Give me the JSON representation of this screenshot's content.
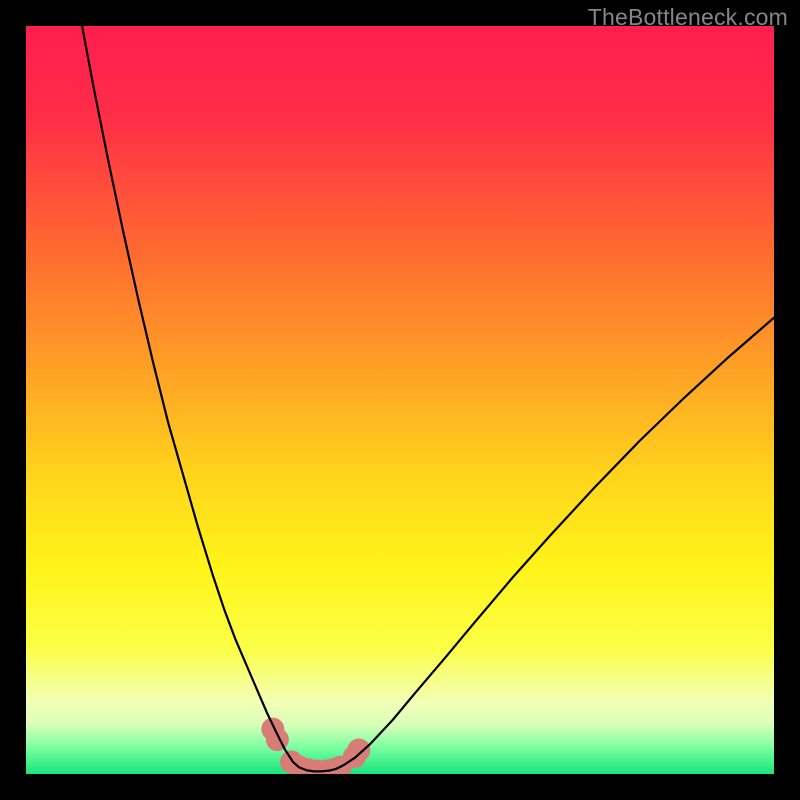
{
  "watermark": "TheBottleneck.com",
  "colors": {
    "frame": "#000000",
    "curve": "#000000",
    "marker_fill": "#d87c77",
    "marker_stroke": "#d87c77"
  },
  "chart_data": {
    "type": "line",
    "title": "",
    "xlabel": "",
    "ylabel": "",
    "xlim": [
      0,
      100
    ],
    "ylim": [
      0,
      100
    ],
    "gradient_stops": [
      {
        "pos": 0.0,
        "color": "#ff1e4e"
      },
      {
        "pos": 0.12,
        "color": "#ff2d48"
      },
      {
        "pos": 0.3,
        "color": "#ff6a30"
      },
      {
        "pos": 0.46,
        "color": "#ffa126"
      },
      {
        "pos": 0.6,
        "color": "#ffd41c"
      },
      {
        "pos": 0.72,
        "color": "#fff319"
      },
      {
        "pos": 0.83,
        "color": "#fbff45"
      },
      {
        "pos": 0.905,
        "color": "#f3ffb6"
      },
      {
        "pos": 0.935,
        "color": "#d6ffb8"
      },
      {
        "pos": 0.965,
        "color": "#7affa0"
      },
      {
        "pos": 1.0,
        "color": "#16e57c"
      }
    ],
    "series": [
      {
        "name": "left-branch",
        "x": [
          7.5,
          9,
          11,
          13,
          15,
          17,
          19,
          21,
          23,
          25,
          26.5,
          28,
          29.5,
          31,
          32.3,
          33.5,
          34.6,
          35.7
        ],
        "y": [
          100,
          92,
          82,
          72.5,
          63.5,
          55,
          47,
          40,
          33,
          26.5,
          22,
          18,
          14.5,
          11,
          8,
          5.5,
          3.3,
          1.6
        ]
      },
      {
        "name": "valley-floor",
        "x": [
          35.7,
          36.5,
          37.5,
          38.5,
          39.5,
          40.5,
          41.5,
          42.5
        ],
        "y": [
          1.6,
          0.9,
          0.5,
          0.35,
          0.35,
          0.45,
          0.7,
          1.2
        ]
      },
      {
        "name": "right-branch",
        "x": [
          42.5,
          44,
          46,
          49,
          52,
          56,
          60,
          65,
          70,
          76,
          82,
          88,
          94,
          100
        ],
        "y": [
          1.2,
          2.2,
          4.0,
          7.2,
          10.8,
          15.5,
          20.3,
          26.2,
          31.8,
          38.3,
          44.5,
          50.3,
          55.8,
          61.0
        ]
      }
    ],
    "markers": {
      "name": "valley-markers",
      "x": [
        33.0,
        33.6,
        35.5,
        36.5,
        37.7,
        38.8,
        40.0,
        41.0,
        42.0,
        43.9,
        44.5
      ],
      "y": [
        6.0,
        4.6,
        1.6,
        0.95,
        0.55,
        0.4,
        0.4,
        0.55,
        0.9,
        2.3,
        3.2
      ],
      "r": 11
    }
  }
}
